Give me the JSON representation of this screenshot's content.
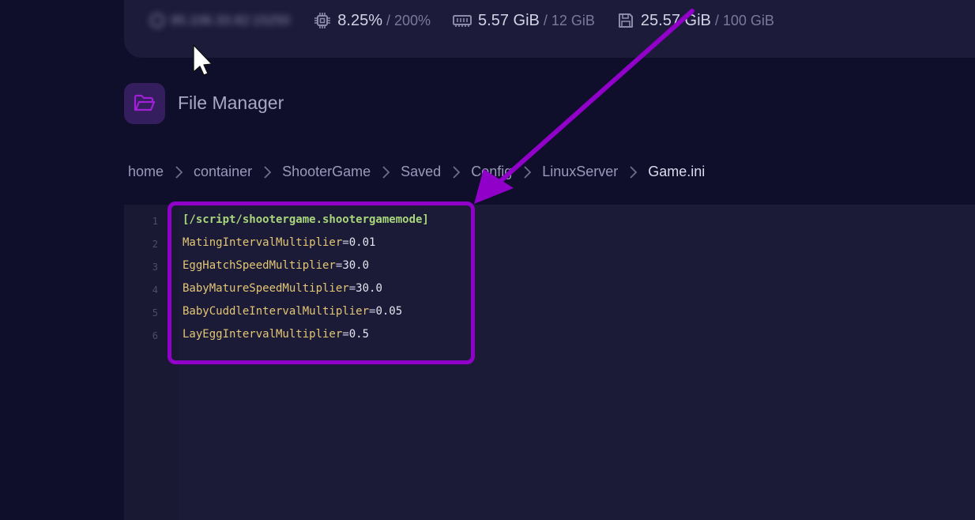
{
  "stats": {
    "ip_masked": "95.106.33.82:15250",
    "cpu": {
      "value": "8.25%",
      "limit": "200%"
    },
    "memory": {
      "value": "5.57 GiB",
      "limit": "12 GiB"
    },
    "disk": {
      "value": "25.57 GiB",
      "limit": "100 GiB"
    },
    "separator": "/"
  },
  "header": {
    "title": "File Manager"
  },
  "breadcrumb": [
    "home",
    "container",
    "ShooterGame",
    "Saved",
    "Config",
    "LinuxServer",
    "Game.ini"
  ],
  "editor": {
    "line_numbers": [
      "1",
      "2",
      "3",
      "4",
      "5",
      "6"
    ],
    "section_header": "[/script/shootergame.shootergamemode]",
    "lines": [
      {
        "key": "MatingIntervalMultiplier",
        "eq": "=",
        "value": "0.01"
      },
      {
        "key": "EggHatchSpeedMultiplier",
        "eq": "=",
        "value": "30.0"
      },
      {
        "key": "BabyMatureSpeedMultiplier",
        "eq": "=",
        "value": "30.0"
      },
      {
        "key": "BabyCuddleIntervalMultiplier",
        "eq": "=",
        "value": "0.05"
      },
      {
        "key": "LayEggIntervalMultiplier",
        "eq": "=",
        "value": "0.5"
      }
    ]
  },
  "colors": {
    "annotation": "#9000c8",
    "section": "#a8d67c",
    "key": "#e2c675"
  }
}
